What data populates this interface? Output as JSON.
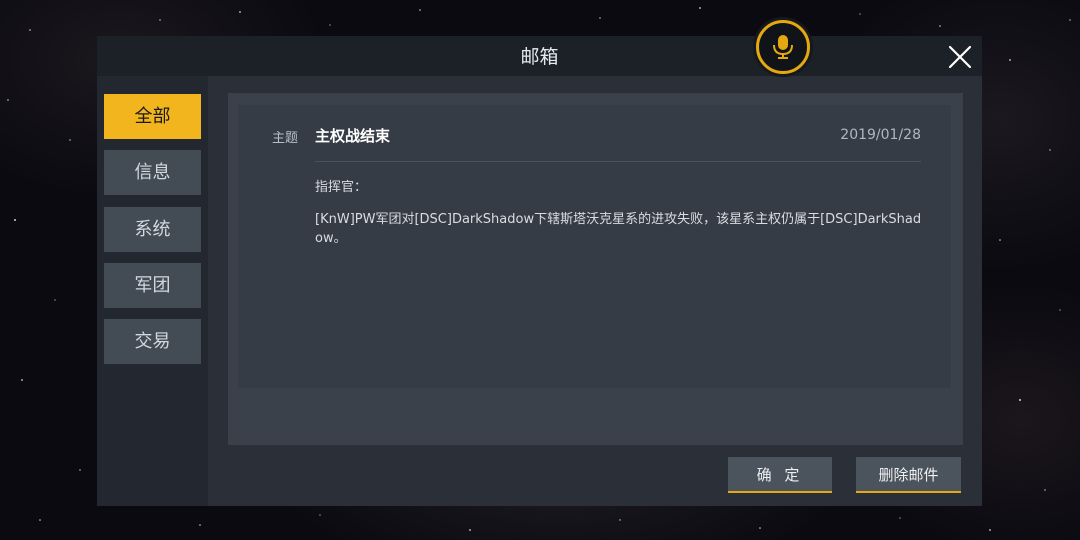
{
  "window": {
    "title": "邮箱"
  },
  "icons": {
    "mic": "microphone-icon",
    "close": "close-icon"
  },
  "sidebar": {
    "tabs": [
      {
        "label": "全部",
        "active": true
      },
      {
        "label": "信息",
        "active": false
      },
      {
        "label": "系统",
        "active": false
      },
      {
        "label": "军团",
        "active": false
      },
      {
        "label": "交易",
        "active": false
      }
    ]
  },
  "mail": {
    "subject_label": "主题",
    "subject": "主权战结束",
    "date": "2019/01/28",
    "greeting": "指挥官：",
    "body": "[KnW]PW军团对[DSC]DarkShadow下辖斯塔沃克星系的进攻失败，该星系主权仍属于[DSC]DarkShadow。"
  },
  "buttons": {
    "confirm": "确 定",
    "delete": "删除邮件"
  },
  "colors": {
    "accent": "#f2b51d",
    "panel": "#2b3038",
    "titlebar": "#1c2027"
  }
}
